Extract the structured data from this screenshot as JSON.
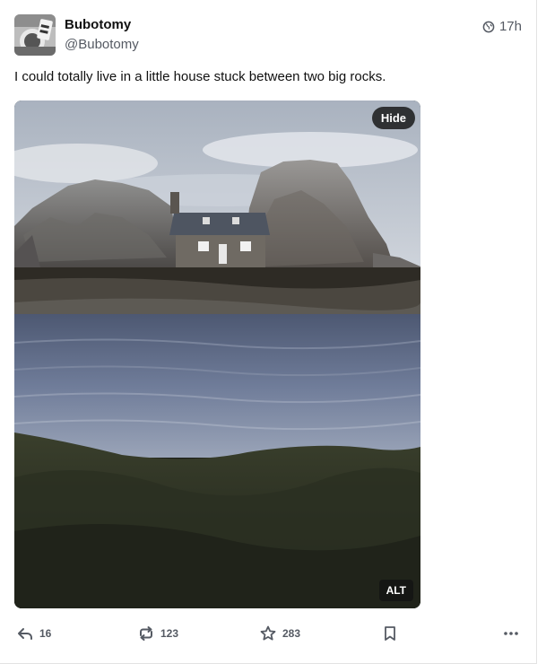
{
  "post": {
    "display_name": "Bubotomy",
    "handle": "@Bubotomy",
    "visibility_icon": "globe-icon",
    "timestamp": "17h",
    "text": "I could totally live in a little house stuck between two big rocks."
  },
  "media": {
    "hide_label": "Hide",
    "alt_label": "ALT"
  },
  "actions": {
    "reply": {
      "icon": "reply-icon",
      "count": "16"
    },
    "boost": {
      "icon": "boost-icon",
      "count": "123"
    },
    "favourite": {
      "icon": "star-icon",
      "count": "283"
    },
    "bookmark": {
      "icon": "bookmark-icon"
    },
    "more": {
      "icon": "more-icon"
    }
  },
  "colors": {
    "text": "#111111",
    "muted": "#555a63",
    "overlay": "#141414"
  }
}
